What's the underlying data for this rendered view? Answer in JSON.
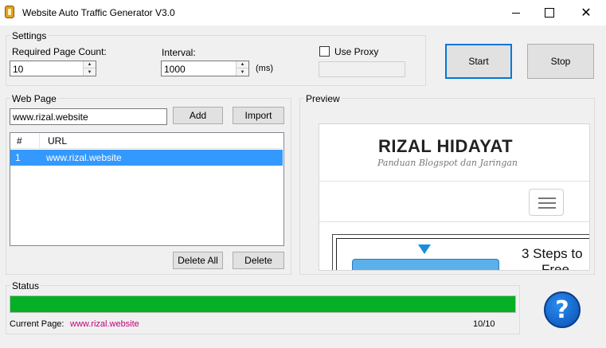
{
  "window": {
    "title": "Website Auto Traffic Generator V3.0"
  },
  "settings": {
    "group_label": "Settings",
    "required_page_count_label": "Required Page Count:",
    "required_page_count_value": "10",
    "interval_label": "Interval:",
    "interval_value": "1000",
    "interval_unit": "(ms)",
    "use_proxy_label": "Use Proxy",
    "use_proxy_checked": false
  },
  "actions": {
    "start_label": "Start",
    "stop_label": "Stop"
  },
  "web_page": {
    "group_label": "Web Page",
    "url_input_value": "www.rizal.website",
    "add_label": "Add",
    "import_label": "Import",
    "columns": [
      "#",
      "URL"
    ],
    "rows": [
      {
        "index": "1",
        "url": "www.rizal.website"
      }
    ],
    "delete_all_label": "Delete All",
    "delete_label": "Delete"
  },
  "preview": {
    "group_label": "Preview",
    "site_title": "RIZAL HIDAYAT",
    "site_subtitle": "Panduan Blogspot dan Jaringan",
    "steps_text": "3 Steps to",
    "steps_text2": "Free"
  },
  "status": {
    "group_label": "Status",
    "progress_fraction": 1.0,
    "current_page_label": "Current Page:",
    "current_page_value": "www.rizal.website",
    "count_text": "10/10",
    "progress_color": "#06b025",
    "link_color": "#c0007a"
  },
  "help": {
    "glyph": "?"
  }
}
